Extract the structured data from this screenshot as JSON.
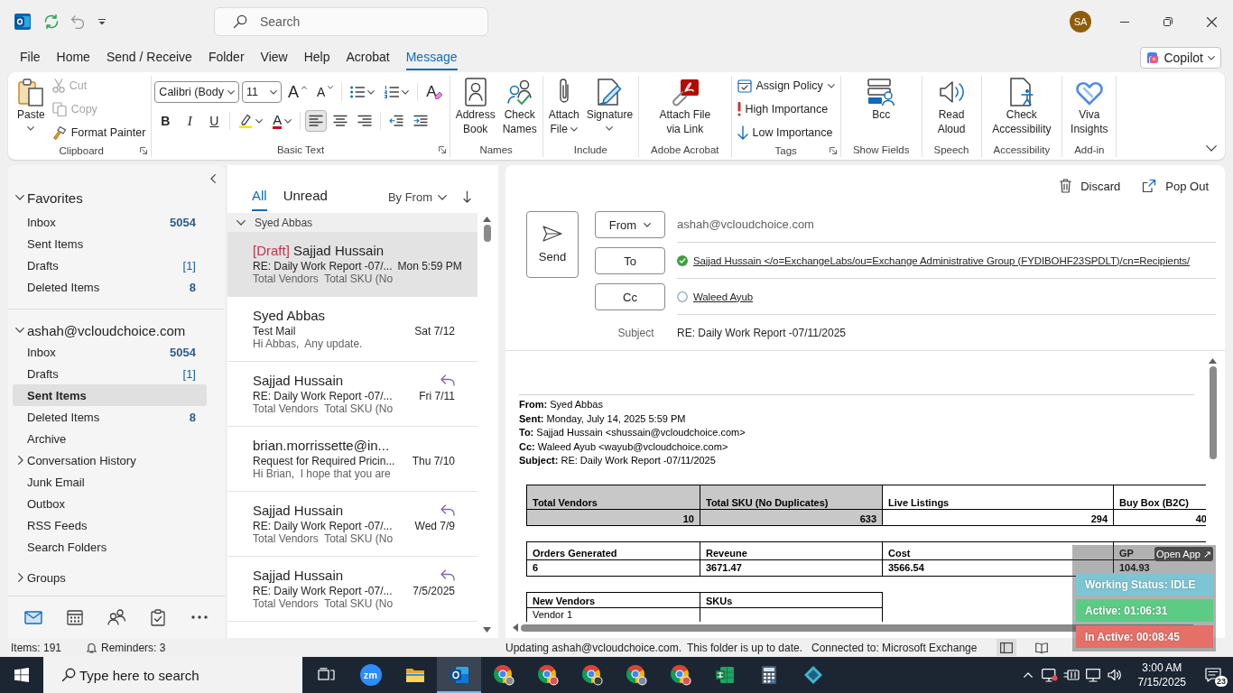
{
  "title_bar": {
    "search": {
      "placeholder": "Search"
    },
    "avatar": {
      "initials": "SA"
    }
  },
  "menu_tabs": [
    {
      "label": "File",
      "selected": false
    },
    {
      "label": "Home",
      "selected": false
    },
    {
      "label": "Send / Receive",
      "selected": false
    },
    {
      "label": "Folder",
      "selected": false
    },
    {
      "label": "View",
      "selected": false
    },
    {
      "label": "Help",
      "selected": false
    },
    {
      "label": "Acrobat",
      "selected": false
    },
    {
      "label": "Message",
      "selected": true
    }
  ],
  "copilot": {
    "label": "Copilot"
  },
  "ribbon": {
    "groups": [
      {
        "label": "Clipboard",
        "launcher": true,
        "items": [
          {
            "kind": "paste",
            "lines": [
              "Paste"
            ],
            "dropdown": true
          },
          {
            "kind": "cut",
            "label": "Cut",
            "disabled": true
          },
          {
            "kind": "copy",
            "label": "Copy",
            "disabled": true
          },
          {
            "kind": "format_painter",
            "label": "Format Painter",
            "disabled": false
          }
        ]
      },
      {
        "label": "Basic Text",
        "launcher": true,
        "items": [
          {
            "kind": "font",
            "value": "Calibri (Body"
          },
          {
            "kind": "size",
            "value": "11"
          },
          {
            "kind": "grow",
            "label": "A"
          },
          {
            "kind": "shrink",
            "label": "A"
          },
          {
            "kind": "bullets",
            "dropdown": true
          },
          {
            "kind": "numbering",
            "dropdown": true
          },
          {
            "kind": "clear",
            "label": "A"
          },
          {
            "kind": "bold",
            "label": "B"
          },
          {
            "kind": "italic",
            "label": "I"
          },
          {
            "kind": "underline",
            "label": "U"
          },
          {
            "kind": "highlight",
            "dropdown": true
          },
          {
            "kind": "font_color",
            "label": "A",
            "dropdown": true
          },
          {
            "kind": "align_left",
            "selected": true
          },
          {
            "kind": "align_center",
            "selected": false
          },
          {
            "kind": "align_right",
            "selected": false
          },
          {
            "kind": "outdent"
          },
          {
            "kind": "indent"
          }
        ]
      },
      {
        "label": "Names",
        "items": [
          {
            "kind": "address_book",
            "lines": [
              "Address",
              "Book"
            ]
          },
          {
            "kind": "check_names",
            "lines": [
              "Check",
              "Names"
            ]
          }
        ]
      },
      {
        "label": "Include",
        "items": [
          {
            "kind": "attach_file",
            "lines": [
              "Attach",
              "File"
            ],
            "dropdown": true
          },
          {
            "kind": "signature",
            "lines": [
              "Signature"
            ],
            "dropdown": true
          }
        ]
      },
      {
        "label": "Adobe Acrobat",
        "items": [
          {
            "kind": "attach_link",
            "lines": [
              "Attach File",
              "via Link"
            ]
          }
        ]
      },
      {
        "label": "Tags",
        "launcher": true,
        "items": [
          {
            "kind": "assign_policy",
            "label": "Assign Policy",
            "dropdown": true
          },
          {
            "kind": "high_importance",
            "label": "High Importance"
          },
          {
            "kind": "low_importance",
            "label": "Low Importance"
          }
        ]
      },
      {
        "label": "Show Fields",
        "items": [
          {
            "kind": "bcc",
            "lines": [
              "Bcc"
            ]
          }
        ]
      },
      {
        "label": "Speech",
        "items": [
          {
            "kind": "read_aloud",
            "lines": [
              "Read",
              "Aloud"
            ]
          }
        ]
      },
      {
        "label": "Accessibility",
        "items": [
          {
            "kind": "check_accessibility",
            "lines": [
              "Check",
              "Accessibility"
            ]
          }
        ]
      },
      {
        "label": "Add-in",
        "items": [
          {
            "kind": "insights",
            "lines": [
              "Viva",
              "Insights"
            ]
          }
        ]
      }
    ]
  },
  "nav_pane": {
    "folders": [
      {
        "kind": "section",
        "label": "Favorites",
        "expanded": true,
        "children": [
          {
            "label": "Inbox",
            "unread_count": "5054",
            "selected": false
          },
          {
            "label": "Sent Items",
            "selected": false
          },
          {
            "label": "Drafts",
            "item_count": "[1]",
            "selected": false
          },
          {
            "label": "Deleted Items",
            "unread_count": "8",
            "selected": false
          }
        ]
      },
      {
        "kind": "section",
        "label": "ashah@vcloudchoice.com",
        "expanded": true,
        "children": [
          {
            "label": "Inbox",
            "unread_count": "5054",
            "selected": false
          },
          {
            "label": "Drafts",
            "item_count": "[1]",
            "selected": false
          },
          {
            "label": "Sent Items",
            "selected": true
          },
          {
            "label": "Deleted Items",
            "unread_count": "8",
            "selected": false
          },
          {
            "label": "Archive",
            "selected": false
          },
          {
            "label": "Conversation History",
            "expanded": false,
            "selected": false
          },
          {
            "label": "Junk Email",
            "selected": false
          },
          {
            "label": "Outbox",
            "selected": false
          },
          {
            "label": "RSS Feeds",
            "selected": false
          },
          {
            "label": "Search Folders",
            "selected": false
          }
        ]
      },
      {
        "kind": "folder",
        "label": "Groups",
        "expanded": false,
        "selected": false
      }
    ],
    "modules": [
      {
        "kind": "mail",
        "selected": true
      },
      {
        "kind": "calendar",
        "selected": false
      },
      {
        "kind": "people",
        "selected": false
      },
      {
        "kind": "tasks",
        "selected": false
      },
      {
        "kind": "more",
        "selected": false
      }
    ]
  },
  "message_list": {
    "filters": [
      {
        "label": "All",
        "selected": true
      },
      {
        "label": "Unread",
        "selected": false
      }
    ],
    "sort": {
      "label": "By From"
    },
    "group": {
      "label": "Syed Abbas",
      "expanded": true
    },
    "items": [
      {
        "draft_tag": "[Draft]",
        "sender": "Sajjad Hussain",
        "subject": "RE: Daily Work Report -07/...",
        "date": "Mon 5:59 PM",
        "preview": "Total Vendors  Total SKU (No",
        "replied": false,
        "selected": true
      },
      {
        "sender": "Syed Abbas",
        "subject": "Test Mail",
        "date": "Sat 7/12",
        "preview": "Hi Abbas,  Any update.",
        "replied": false,
        "selected": false
      },
      {
        "sender": "Sajjad Hussain",
        "subject": "RE: Daily Work Report -07/...",
        "date": "Fri 7/11",
        "preview": "Total Vendors  Total SKU (No",
        "replied": true,
        "selected": false
      },
      {
        "sender": "brian.morrissette@in...",
        "subject": "Request for Required Pricin...",
        "date": "Thu 7/10",
        "preview": "Hi Brian,  I hope that you are",
        "replied": false,
        "selected": false
      },
      {
        "sender": "Sajjad Hussain",
        "subject": "RE: Daily Work Report -07/...",
        "date": "Wed 7/9",
        "preview": "Total Vendors  Total SKU (No",
        "replied": true,
        "selected": false
      },
      {
        "sender": "Sajjad Hussain",
        "subject": "RE: Daily Work Report -07/...",
        "date": "7/5/2025",
        "preview": "Total Vendors  Total SKU (No",
        "replied": true,
        "selected": false
      }
    ]
  },
  "compose": {
    "actions": [
      {
        "kind": "discard",
        "label": "Discard"
      },
      {
        "kind": "pop_out",
        "label": "Pop Out"
      }
    ],
    "send": {
      "label": "Send"
    },
    "from": {
      "label": "From",
      "value": "ashah@vcloudchoice.com"
    },
    "to": {
      "label": "To",
      "recipients": [
        {
          "name": "Sajjad Hussain </o=ExchangeLabs/ou=Exchange Administrative Group (FYDIBOHF23SPDLT)/cn=Recipients/",
          "resolved": true
        }
      ]
    },
    "cc": {
      "label": "Cc",
      "recipients": [
        {
          "name": "Waleed Ayub",
          "resolved": false
        }
      ]
    },
    "subject": {
      "label": "Subject",
      "value": "RE: Daily Work Report -07/11/2025"
    },
    "body": {
      "header_lines": [
        "**From:** Syed Abbas",
        "**Sent:** Monday, July 14, 2025 5:59 PM",
        "**To:** Sajjad Hussain <shussain@vcloudchoice.com>",
        "**Cc:** Waleed Ayub <wayub@vcloudchoice.com>",
        "**Subject:** RE: Daily Work Report -07/11/2025"
      ],
      "tables": [
        {
          "kind": "summary",
          "columns": [
            {
              "label": "Total Vendors",
              "shaded": true
            },
            {
              "label": "Total SKU (No Duplicates)",
              "shaded": true
            },
            {
              "label": "Live Listings",
              "shaded": false
            },
            {
              "label": "Buy Box (B2C)",
              "shaded": false
            }
          ],
          "rows": [
            [
              "10",
              "633",
              "294",
              "40"
            ]
          ]
        },
        {
          "kind": "figures",
          "columns": [
            {
              "label": "Orders Generated"
            },
            {
              "label": "Reveune"
            },
            {
              "label": "Cost"
            },
            {
              "label": "GP"
            }
          ],
          "rows": [
            [
              "6",
              "3671.47",
              "3566.54",
              "104.93"
            ]
          ]
        },
        {
          "kind": "list",
          "columns": [
            {
              "label": "New Vendors"
            },
            {
              "label": "SKUs"
            }
          ],
          "rows": [
            [
              "Vendor 1"
            ]
          ]
        }
      ]
    }
  },
  "tracker_widget": {
    "open_app": "Open App ↗",
    "statuses": [
      {
        "label": "Working Status: IDLE",
        "color": "#7cc5d4"
      },
      {
        "label": "Active: 01:06:31",
        "color": "#5ccc85"
      },
      {
        "label": "In Active: 00:08:45",
        "color": "#e66f68"
      }
    ]
  },
  "status_bar": {
    "items": "Items: 191",
    "reminders": "Reminders: 3",
    "sync": [
      "Updating ashah@vcloudchoice.com.",
      "This folder is up to date."
    ],
    "connection": "Connected to: Microsoft Exchange",
    "views": [
      {
        "kind": "normal",
        "selected": true
      },
      {
        "kind": "reading",
        "selected": false
      }
    ]
  },
  "taskbar": {
    "search": {
      "placeholder": "Type here to search"
    },
    "apps": [
      {
        "kind": "task_view",
        "active": false
      },
      {
        "kind": "video_meeting",
        "label": "zm",
        "active": false
      },
      {
        "kind": "files",
        "active": false
      },
      {
        "kind": "mail",
        "active": true
      },
      {
        "kind": "browser",
        "color": "#8a8a8a",
        "active": false
      },
      {
        "kind": "browser",
        "color": "#d9534f",
        "active": false
      },
      {
        "kind": "browser",
        "color": "#3a3a3a",
        "active": false
      },
      {
        "kind": "browser",
        "color": "#7a8ca0",
        "active": false
      },
      {
        "kind": "browser",
        "color": "#d9534f",
        "active": false
      },
      {
        "kind": "spreadsheet",
        "active": false
      },
      {
        "kind": "calculator",
        "active": false
      },
      {
        "kind": "diamond_app",
        "active": false
      }
    ],
    "clock": {
      "time": "3:00 AM",
      "date": "7/15/2025"
    },
    "notifications": {
      "count": "23"
    }
  }
}
